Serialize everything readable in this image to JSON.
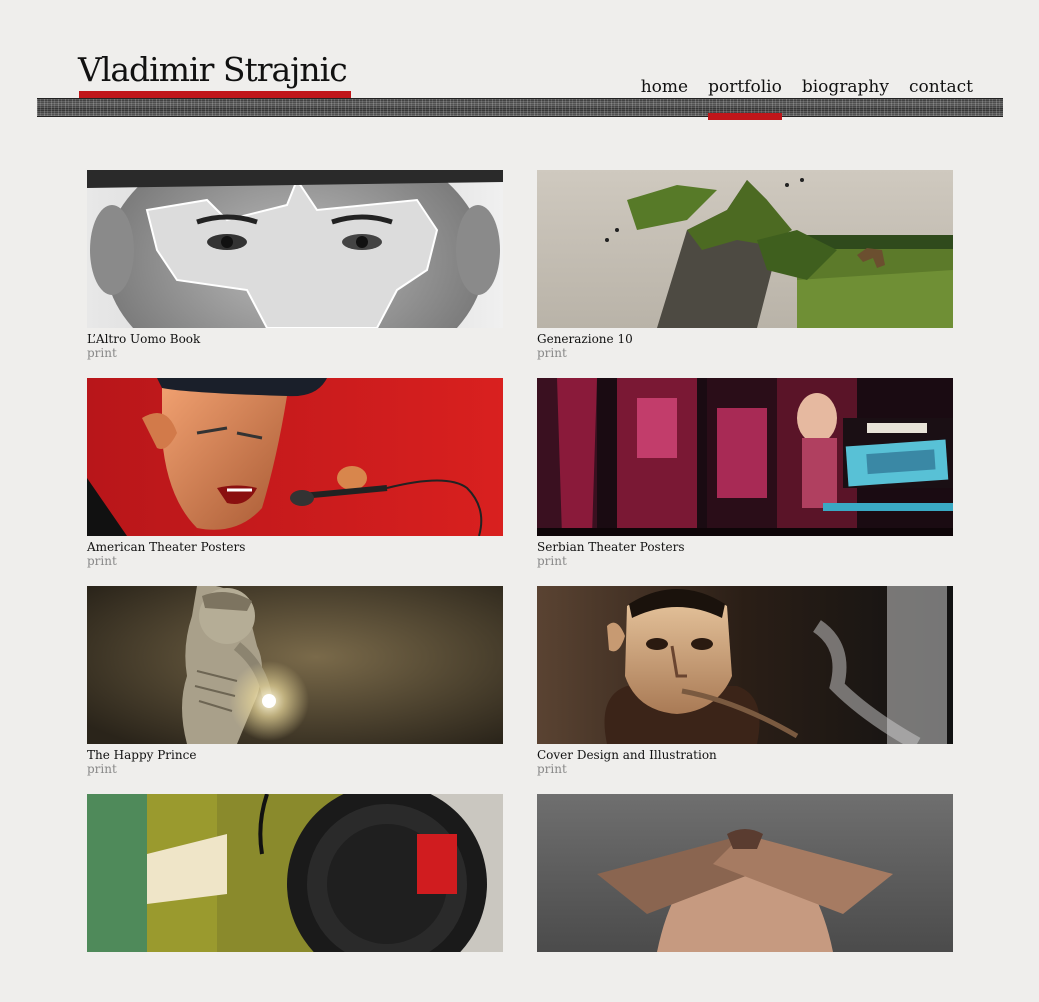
{
  "site": {
    "title": "Vladimir Strajnic",
    "accent": "#c0161a",
    "background": "#efeeec"
  },
  "nav": {
    "items": [
      {
        "label": "home",
        "active": false
      },
      {
        "label": "portfolio",
        "active": true
      },
      {
        "label": "biography",
        "active": false
      },
      {
        "label": "contact",
        "active": false
      }
    ]
  },
  "portfolio": {
    "items": [
      {
        "title": "L’Altro Uomo Book",
        "category": "print",
        "image": "torn-paper-face-image"
      },
      {
        "title": "Generazione 10",
        "category": "print",
        "image": "tree-landscape-image"
      },
      {
        "title": "American Theater Posters",
        "category": "print",
        "image": "elvis-microphone-image"
      },
      {
        "title": "Serbian Theater Posters",
        "category": "print",
        "image": "serbian-poster-image"
      },
      {
        "title": "The Happy Prince",
        "category": "print",
        "image": "happy-prince-image"
      },
      {
        "title": "Cover Design and Illustration",
        "category": "print",
        "image": "pipe-portrait-image"
      },
      {
        "title": "",
        "category": "",
        "image": "record-cover-image"
      },
      {
        "title": "",
        "category": "",
        "image": "crossed-arms-image"
      }
    ]
  }
}
